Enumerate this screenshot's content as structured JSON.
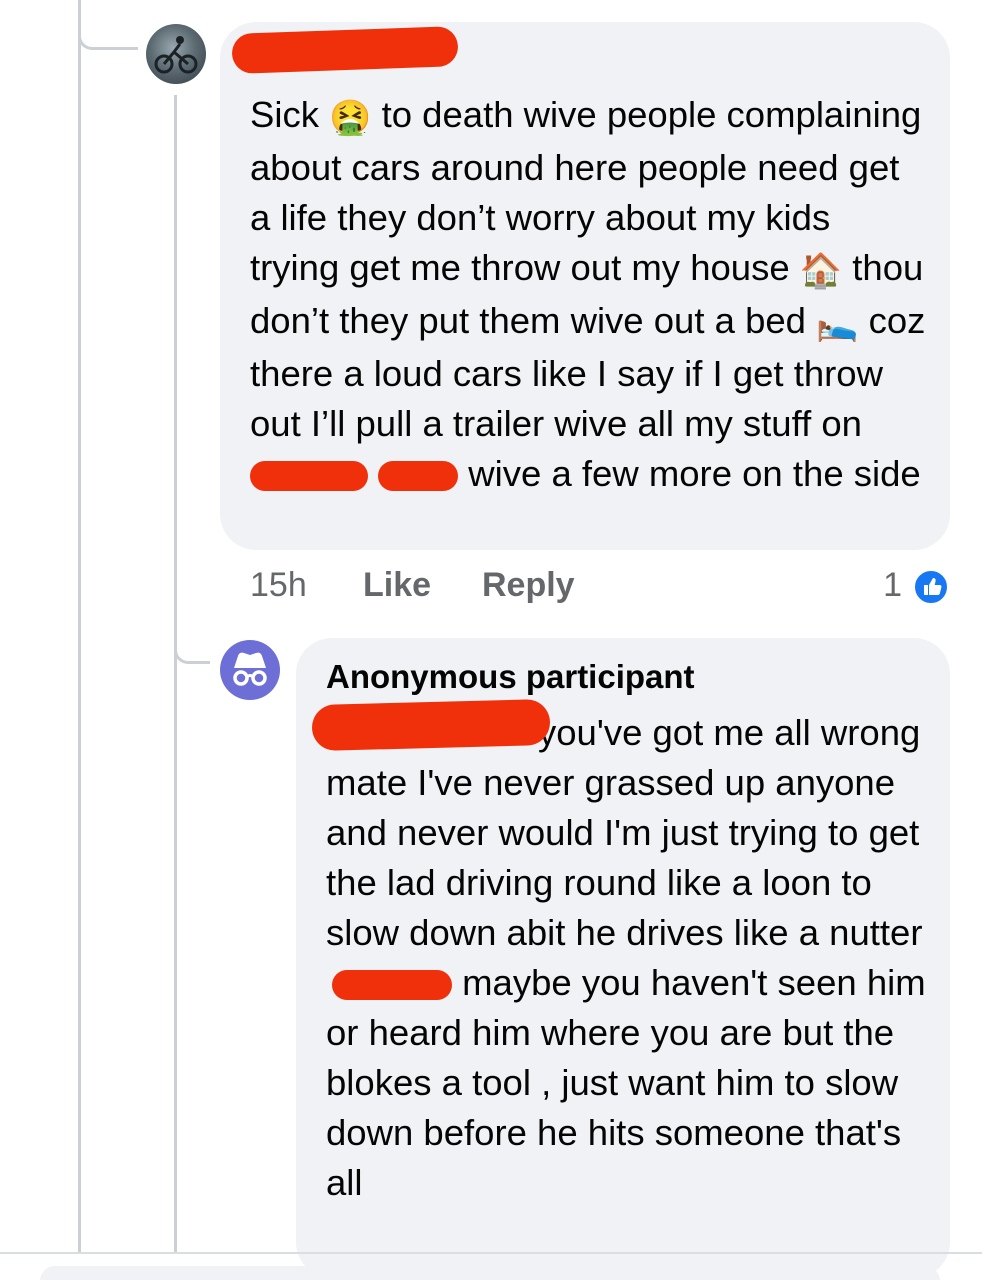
{
  "comments": [
    {
      "author": "",
      "text_parts": {
        "p1": "Sick ",
        "p2": " to death wive people complaining about cars around here people need get a life they don’t worry about my kids trying get me throw out my house ",
        "p3": " thou don’t they put them wive out a bed ",
        "p4": " coz there a loud cars like I say if I get throw out I’ll pull a trailer wive all my stuff on ",
        "p5": " wive a few more on the side"
      },
      "emojis": {
        "e1": "🤮",
        "e2": "🏠",
        "e3": "🛌"
      },
      "time": "15h",
      "like_label": "Like",
      "reply_label": "Reply",
      "reaction_count": "1"
    },
    {
      "author": "Anonymous participant",
      "text_parts": {
        "p1": "you've got me all wrong mate I've never grassed up anyone and never would I'm just trying to get the lad driving round like a loon to slow down abit he drives like a nutter",
        "p2": " maybe you haven't seen him or heard him where you are but the blokes a tool , just want him to slow down before he hits someone that's all"
      }
    }
  ],
  "colors": {
    "bubble": "#f0f2f5",
    "redaction": "#f0300a",
    "like_blue": "#1877f2",
    "anon_avatar": "#6d6fd6",
    "meta_text": "#65676b"
  },
  "icons": {
    "avatar_1": "profile-photo-cyclist",
    "avatar_2": "incognito-icon",
    "reaction": "thumbs-up-icon"
  }
}
